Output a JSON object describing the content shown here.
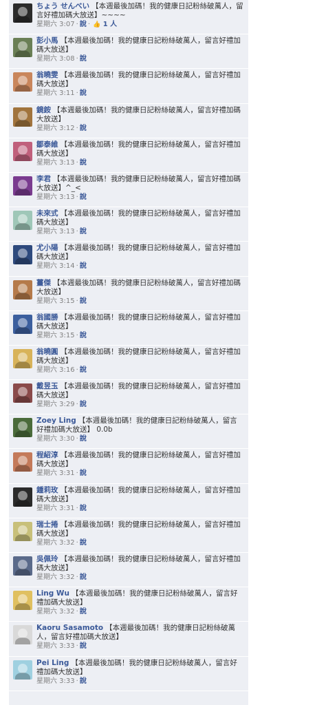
{
  "comments": [
    {
      "author": "ちょう せんべい",
      "text": "【本週最後加碼！我的健康日記粉絲破萬人，留言好禮加碼大放送】~~~~",
      "time": "星期六 3:07",
      "action": "說",
      "likes": "1 人",
      "avatar_color": "#2b2b2b"
    },
    {
      "author": "彭小馬",
      "text": "【本週最後加碼！我的健康日記粉絲破萬人，留言好禮加碼大放送】",
      "time": "星期六 3:08",
      "action": "說",
      "avatar_color": "#6a7f55"
    },
    {
      "author": "翁曉雯",
      "text": "【本週最後加碼！我的健康日記粉絲破萬人，留言好禮加碼大放送】",
      "time": "星期六 3:11",
      "action": "說",
      "avatar_color": "#c9865c"
    },
    {
      "author": "鏡銨",
      "text": "【本週最後加碼！我的健康日記粉絲破萬人，留言好禮加碼大放送】",
      "time": "星期六 3:12",
      "action": "說",
      "avatar_color": "#a1743d"
    },
    {
      "author": "鄒泰維",
      "text": "【本週最後加碼！我的健康日記粉絲破萬人，留言好禮加碼大放送】",
      "time": "星期六 3:13",
      "action": "說",
      "avatar_color": "#c0607c"
    },
    {
      "author": "李君",
      "text": "【本週最後加碼！我的健康日記粉絲破萬人，留言好禮加碼大放送】^_<",
      "time": "星期六 3:13",
      "action": "說",
      "avatar_color": "#7a3b8f"
    },
    {
      "author": "未來式",
      "text": "【本週最後加碼！我的健康日記粉絲破萬人，留言好禮加碼大放送】",
      "time": "星期六 3:13",
      "action": "說",
      "avatar_color": "#9fc7b8"
    },
    {
      "author": "尤小陽",
      "text": "【本週最後加碼！我的健康日記粉絲破萬人，留言好禮加碼大放送】",
      "time": "星期六 3:14",
      "action": "說",
      "avatar_color": "#2e4a7d"
    },
    {
      "author": "薑傑",
      "text": "【本週最後加碼！我的健康日記粉絲破萬人，留言好禮加碼大放送】",
      "time": "星期六 3:15",
      "action": "說",
      "avatar_color": "#b57a4a"
    },
    {
      "author": "翁國勝",
      "text": "【本週最後加碼！我的健康日記粉絲破萬人，留言好禮加碼大放送】",
      "time": "星期六 3:15",
      "action": "說",
      "avatar_color": "#3c5f9e"
    },
    {
      "author": "翁曉圓",
      "text": "【本週最後加碼！我的健康日記粉絲破萬人，留言好禮加碼大放送】",
      "time": "星期六 3:16",
      "action": "說",
      "avatar_color": "#d8b35a"
    },
    {
      "author": "戴昱玉",
      "text": "【本週最後加碼！我的健康日記粉絲破萬人，留言好禮加碼大放送】",
      "time": "星期六 3:29",
      "action": "說",
      "avatar_color": "#8a4a4a"
    },
    {
      "author": "Zoey Ling",
      "text": "【本週最後加碼！我的健康日記粉絲破萬人，留言好禮加碼大放送】 0.0b",
      "time": "星期六 3:30",
      "action": "說",
      "avatar_color": "#4a6b3a"
    },
    {
      "author": "程紹淳",
      "text": "【本週最後加碼！我的健康日記粉絲破萬人，留言好禮加碼大放送】",
      "time": "星期六 3:31",
      "action": "說",
      "avatar_color": "#c47a5a"
    },
    {
      "author": "鍾莉玫",
      "text": "【本週最後加碼！我的健康日記粉絲破萬人，留言好禮加碼大放送】",
      "time": "星期六 3:31",
      "action": "說",
      "avatar_color": "#2b2b2b"
    },
    {
      "author": "瑞士捲",
      "text": "【本週最後加碼！我的健康日記粉絲破萬人，留言好禮加碼大放送】",
      "time": "星期六 3:32",
      "action": "說",
      "avatar_color": "#c8c07a"
    },
    {
      "author": "吳佩玲",
      "text": "【本週最後加碼！我的健康日記粉絲破萬人，留言好禮加碼大放送】",
      "time": "星期六 3:32",
      "action": "說",
      "avatar_color": "#5a6a8a"
    },
    {
      "author": "Ling Wu",
      "text": "【本週最後加碼！我的健康日記粉絲破萬人，留言好禮加碼大放送】",
      "time": "星期六 3:32",
      "action": "說",
      "avatar_color": "#e0c060"
    },
    {
      "author": "Kaoru Sasamoto",
      "text": "【本週最後加碼！我的健康日記粉絲破萬人，留言好禮加碼大放送】",
      "time": "星期六 3:33",
      "action": "說",
      "avatar_color": "#d9d9d9"
    },
    {
      "author": "Pei Ling",
      "text": "【本週最後加碼！我的健康日記粉絲破萬人，留言好禮加碼大放送】",
      "time": "星期六 3:33",
      "action": "說",
      "avatar_color": "#9fd0e0"
    }
  ]
}
